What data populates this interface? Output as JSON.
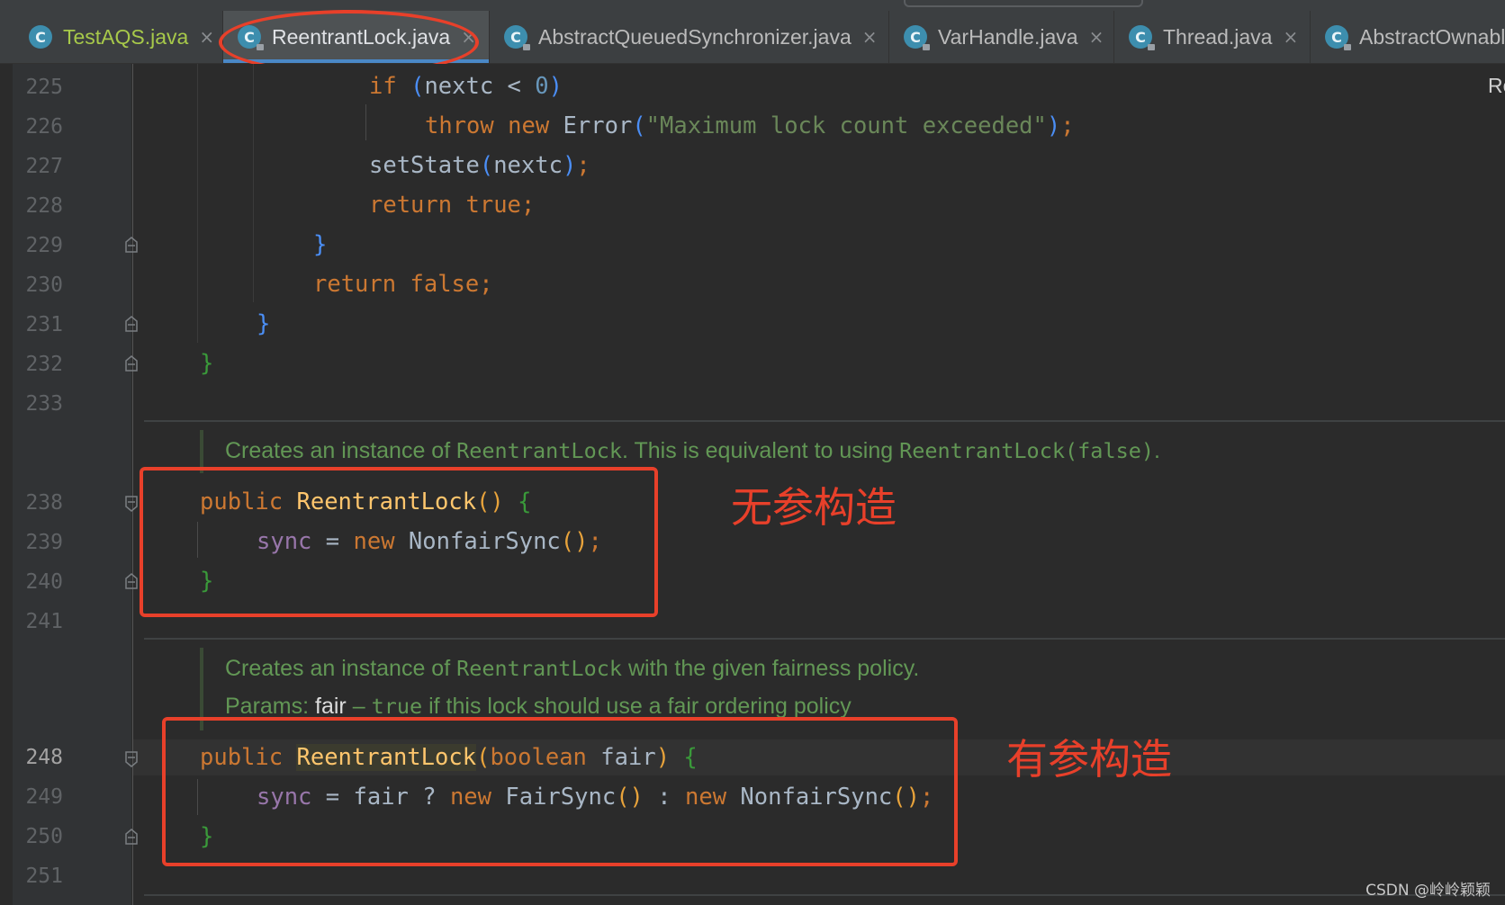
{
  "tabs": [
    {
      "label": "TestAQS.java",
      "icon": "c-class-icon",
      "has_close": true
    },
    {
      "label": "ReentrantLock.java",
      "icon": "c-class-locked-icon",
      "active": true,
      "has_close": true
    },
    {
      "label": "AbstractQueuedSynchronizer.java",
      "icon": "c-class-locked-icon",
      "has_close": true
    },
    {
      "label": "VarHandle.java",
      "icon": "c-class-locked-icon",
      "has_close": true
    },
    {
      "label": "Thread.java",
      "icon": "c-class-locked-icon",
      "has_close": true
    },
    {
      "label": "AbstractOwnabl",
      "icon": "c-class-locked-icon",
      "has_close": false
    }
  ],
  "tab_icon_letter": "C",
  "tab_close_glyph": "×",
  "line_numbers": [
    "225",
    "226",
    "227",
    "228",
    "229",
    "230",
    "231",
    "232",
    "233",
    "238",
    "239",
    "240",
    "241",
    "248",
    "249",
    "250",
    "251"
  ],
  "current_line": "248",
  "code": {
    "l225_kw": "if",
    "l225_paren_open": "(",
    "l225_var": "nextc",
    "l225_op": " < ",
    "l225_num": "0",
    "l225_paren_close": ")",
    "l226_throw": "throw",
    "l226_new": "new",
    "l226_class": "Error",
    "l226_str": "\"Maximum lock count exceeded\"",
    "l226_close": ")",
    "l226_semi": ";",
    "l227_call": "setState",
    "l227_open": "(",
    "l227_arg": "nextc",
    "l227_close": ")",
    "l227_semi": ";",
    "l228_return": "return",
    "l228_true": "true",
    "l228_semi": ";",
    "l229_brace": "}",
    "l230_return": "return",
    "l230_false": "false",
    "l230_semi": ";",
    "l231_brace": "}",
    "l232_brace": "}",
    "l238_public": "public",
    "l238_name": "ReentrantLock",
    "l238_parens": "()",
    "l238_brace": "{",
    "l239_field": "sync",
    "l239_eq": " = ",
    "l239_new": "new",
    "l239_class": "NonfairSync",
    "l239_parens": "()",
    "l239_semi": ";",
    "l240_brace": "}",
    "l248_public": "public",
    "l248_name": "ReentrantLock",
    "l248_open": "(",
    "l248_type": "boolean",
    "l248_param": "fair",
    "l248_close": ")",
    "l248_brace": "{",
    "l249_field": "sync",
    "l249_eq": " = ",
    "l249_cond": "fair ? ",
    "l249_new1": "new",
    "l249_class1": "FairSync",
    "l249_parens1": "()",
    "l249_colon": " : ",
    "l249_new2": "new",
    "l249_class2": "NonfairSync",
    "l249_parens2": "()",
    "l249_semi": ";",
    "l250_brace": "}"
  },
  "doc1": {
    "t1": "Creates an instance of ",
    "c1": "ReentrantLock",
    "t2": ". This is equivalent to using ",
    "c2": "ReentrantLock(false)",
    "t3": "."
  },
  "doc2": {
    "t1": "Creates an instance of ",
    "c1": "ReentrantLock",
    "t2": " with the given fairness policy."
  },
  "doc3": {
    "t1": "Params: ",
    "param": "fair",
    "t2": " – ",
    "c1": "true",
    "t3": " if this lock should use a fair ordering policy"
  },
  "annotations": {
    "no_arg": "无参构造",
    "with_arg": "有参构造"
  },
  "right_edge_text": "Re",
  "watermark": "CSDN @岭岭颖颖",
  "colors": {
    "annotation": "#e8402a",
    "keyword": "#cc7832",
    "string": "#6a8759",
    "doc": "#629755",
    "active_tab_underline": "#4a88c7"
  }
}
